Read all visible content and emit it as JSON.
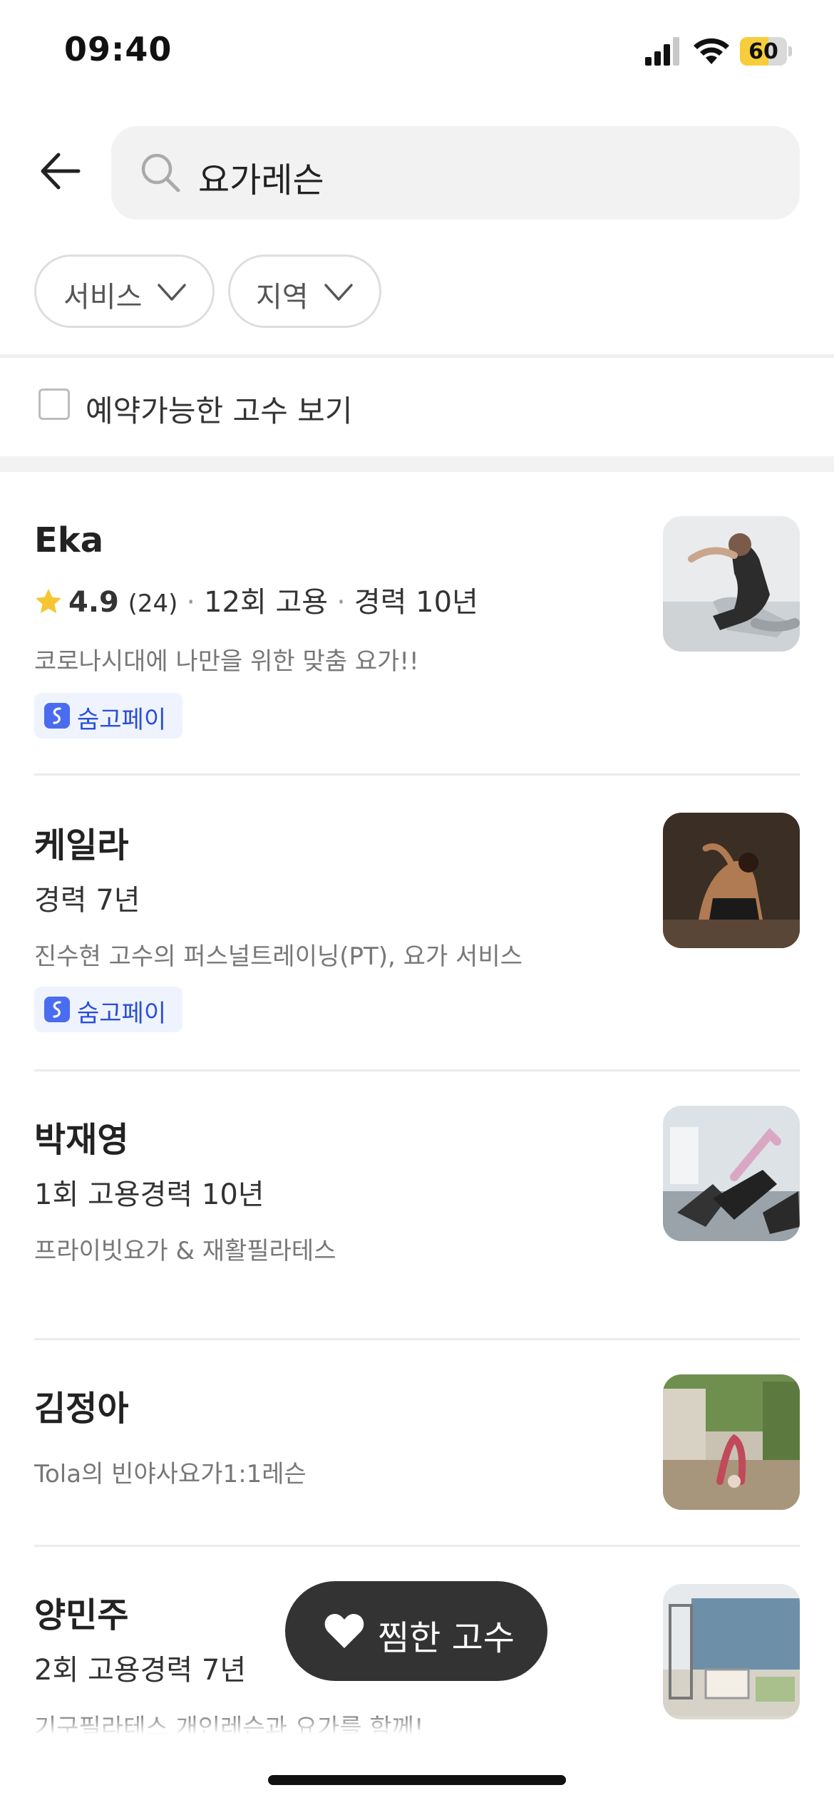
{
  "status_bar": {
    "time": "09:40",
    "battery": "60",
    "battery_level": 0.6
  },
  "search": {
    "query": "요가레슨"
  },
  "filters": [
    {
      "label": "서비스"
    },
    {
      "label": "지역"
    }
  ],
  "availability": {
    "label": "예약가능한 고수 보기",
    "checked": false
  },
  "pros": [
    {
      "name": "Eka",
      "rating": "4.9",
      "reviews": "(24)",
      "hires": "12회 고용",
      "career": "경력 10년",
      "desc": "코로나시대에 나만을 위한 맞춤 요가!!",
      "badge": "숨고페이"
    },
    {
      "name": "케일라",
      "meta": "경력 7년",
      "desc": "진수현 고수의 퍼스널트레이닝(PT), 요가 서비스",
      "badge": "숨고페이"
    },
    {
      "name": "박재영",
      "meta": "1회 고용경력 10년",
      "desc": "프라이빗요가 & 재활필라테스"
    },
    {
      "name": "김정아",
      "desc": "Tola의 빈야사요가1:1레슨"
    },
    {
      "name": "양민주",
      "meta": "2회 고용경력 7년",
      "desc": "기구필라테스 개인레슨과 요가를 함께!"
    }
  ],
  "fab": {
    "label": "찜한 고수"
  },
  "colors": {
    "accent_blue": "#2b4fd6",
    "star": "#f7c531",
    "fab_bg": "#333333"
  }
}
